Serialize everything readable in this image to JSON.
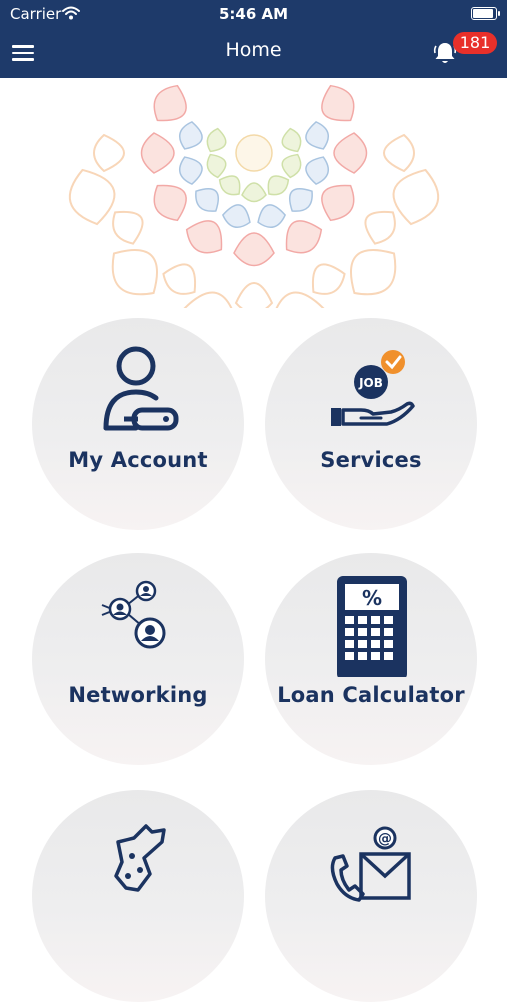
{
  "status_bar": {
    "carrier": "Carrier",
    "time": "5:46 AM"
  },
  "nav": {
    "title": "Home",
    "notification_count": "181"
  },
  "colors": {
    "primary": "#1e3a6a",
    "badge": "#e8302a",
    "tile_text": "#1b3360",
    "accent": "#f0902c"
  },
  "tiles": [
    {
      "label": "My Account",
      "icon": "user-key-icon"
    },
    {
      "label": "Services",
      "icon": "hand-job-icon"
    },
    {
      "label": "Networking",
      "icon": "network-icon"
    },
    {
      "label": "Loan Calculator",
      "icon": "calculator-icon"
    },
    {
      "label": "",
      "icon": "map-icon"
    },
    {
      "label": "",
      "icon": "contact-icon"
    }
  ]
}
